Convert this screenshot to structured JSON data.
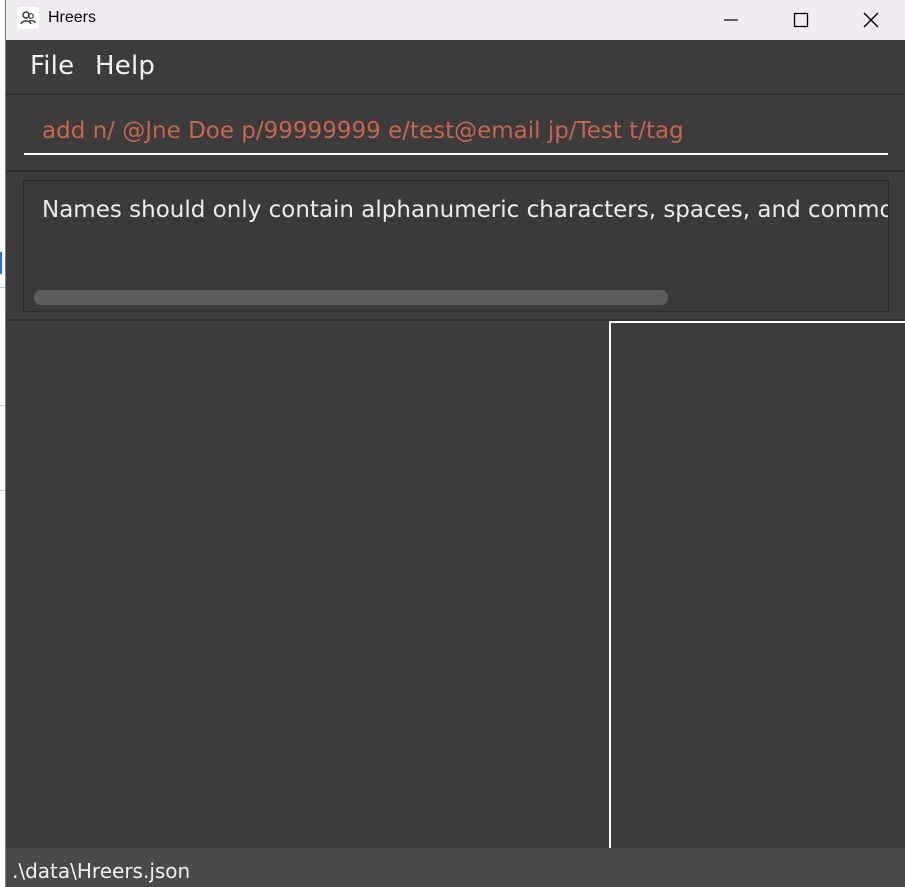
{
  "window": {
    "title": "Hreers",
    "icon": "app-logo-icon"
  },
  "menu": {
    "file": "File",
    "help": "Help"
  },
  "command_box": {
    "value": "add n/ @Jne Doe p/99999999 e/test@email jp/Test t/tag"
  },
  "result_display": {
    "text": "Names should only contain alphanumeric characters, spaces, and common na"
  },
  "status_bar": {
    "file_path": ".\\data\\Hreers.json"
  },
  "colors": {
    "window_bg": "#3c3c3c",
    "titlebar_bg": "#f1ecf1",
    "error_text": "#c8654e",
    "panel_border": "#ffffff"
  }
}
